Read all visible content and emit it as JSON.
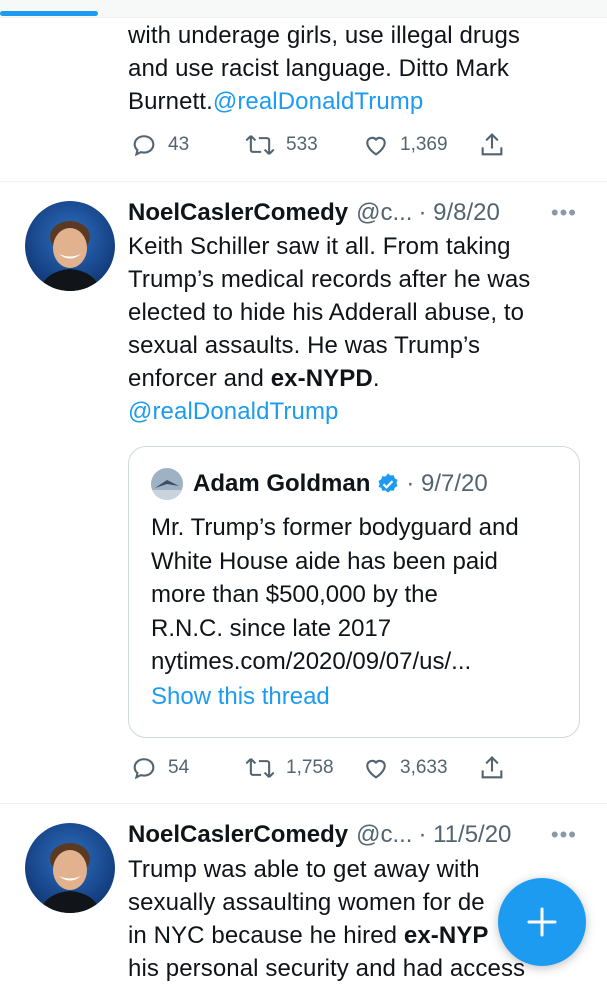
{
  "tweet_prev": {
    "text_lines": [
      "with underage girls, use illegal drugs",
      "and use racist language. Ditto Mark"
    ],
    "text_line3": "Burnett.",
    "mention": "@realDonaldTrump",
    "reply_count": "43",
    "retweet_count": "533",
    "like_count": "1,369"
  },
  "tweet_main": {
    "display_name": "NoelCaslerComedy",
    "handle": "@c...",
    "date": "· 9/8/20",
    "more": "•••",
    "text_lines": [
      "Keith Schiller saw it all. From taking",
      "Trump’s medical records after he was",
      "elected to hide his Adderall abuse, to",
      "sexual assaults. He was Trump’s"
    ],
    "text_line5_pre": "enforcer and ",
    "text_line5_bold": "ex-NYPD",
    "text_line5_post": ".",
    "mention": "@realDonaldTrump",
    "quote": {
      "author": "Adam Goldman",
      "date": "· 9/7/20",
      "text_lines": [
        "Mr. Trump’s former bodyguard and",
        "White House aide has been paid",
        "more than $500,000 by the",
        "R.N.C. since late 2017",
        "nytimes.com/2020/09/07/us/..."
      ],
      "thread_link": "Show this thread"
    },
    "reply_count": "54",
    "retweet_count": "1,758",
    "like_count": "3,633"
  },
  "tweet_next": {
    "display_name": "NoelCaslerComedy",
    "handle": "@c...",
    "date": "· 11/5/20",
    "more": "•••",
    "text_line1": "Trump was able to get away with",
    "text_line2": "sexually assaulting women for de",
    "text_line3_pre": "in NYC because he hired ",
    "text_line3_bold": "ex-NYP",
    "text_line4": "his personal security and had access"
  },
  "colors": {
    "accent": "#1d9bf0",
    "muted": "#536471",
    "text": "#0f1419"
  },
  "icons": [
    "reply-icon",
    "retweet-icon",
    "like-icon",
    "share-icon",
    "verified-badge-icon",
    "compose-plus-icon"
  ]
}
